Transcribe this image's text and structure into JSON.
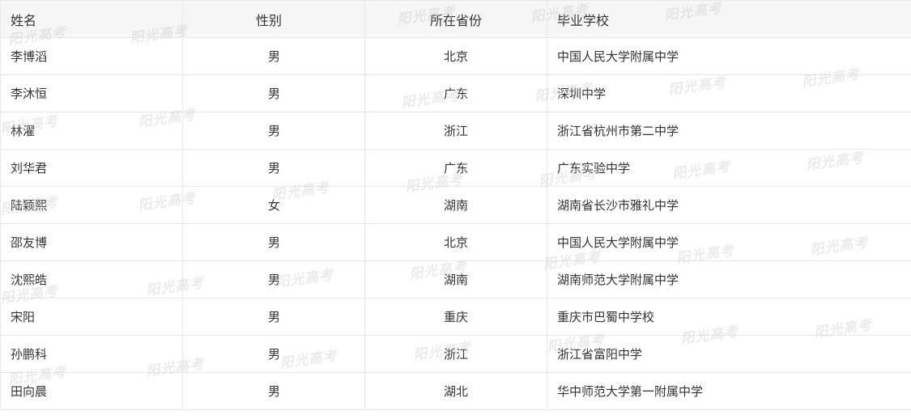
{
  "table": {
    "headers": {
      "name": "姓名",
      "gender": "性别",
      "province": "所在省份",
      "school": "毕业学校"
    },
    "rows": [
      {
        "name": "李博滔",
        "gender": "男",
        "province": "北京",
        "school": "中国人民大学附属中学"
      },
      {
        "name": "李沐恒",
        "gender": "男",
        "province": "广东",
        "school": "深圳中学"
      },
      {
        "name": "林濯",
        "gender": "男",
        "province": "浙江",
        "school": "浙江省杭州市第二中学"
      },
      {
        "name": "刘华君",
        "gender": "男",
        "province": "广东",
        "school": "广东实验中学"
      },
      {
        "name": "陆颖熙",
        "gender": "女",
        "province": "湖南",
        "school": "湖南省长沙市雅礼中学"
      },
      {
        "name": "邵友博",
        "gender": "男",
        "province": "北京",
        "school": "中国人民大学附属中学"
      },
      {
        "name": "沈熙皓",
        "gender": "男",
        "province": "湖南",
        "school": "湖南师范大学附属中学"
      },
      {
        "name": "宋阳",
        "gender": "男",
        "province": "重庆",
        "school": "重庆市巴蜀中学校"
      },
      {
        "name": "孙鹏科",
        "gender": "男",
        "province": "浙江",
        "school": "浙江省富阳中学"
      },
      {
        "name": "田向晨",
        "gender": "男",
        "province": "湖北",
        "school": "华中师范大学第一附属中学"
      }
    ]
  },
  "watermark": {
    "text": "阳光高考"
  }
}
